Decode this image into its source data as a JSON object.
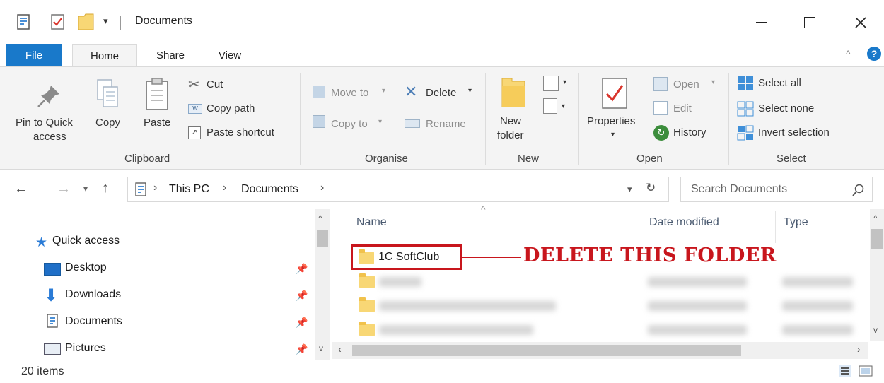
{
  "window": {
    "title": "Documents",
    "controls": {
      "minimize": "—",
      "maximize": "☐",
      "close": "✕"
    }
  },
  "tabs": [
    {
      "label": "File"
    },
    {
      "label": "Home"
    },
    {
      "label": "Share"
    },
    {
      "label": "View"
    }
  ],
  "ribbon": {
    "clipboard": {
      "pin_line1": "Pin to Quick",
      "pin_line2": "access",
      "copy": "Copy",
      "paste": "Paste",
      "cut": "Cut",
      "copy_path": "Copy path",
      "paste_shortcut": "Paste shortcut",
      "group": "Clipboard"
    },
    "organise": {
      "move_to": "Move to",
      "copy_to": "Copy to",
      "delete": "Delete",
      "rename": "Rename",
      "group": "Organise"
    },
    "new": {
      "new_folder_line1": "New",
      "new_folder_line2": "folder",
      "group": "New"
    },
    "open": {
      "properties": "Properties",
      "open": "Open",
      "edit": "Edit",
      "history": "History",
      "group": "Open"
    },
    "select": {
      "select_all": "Select all",
      "select_none": "Select none",
      "invert": "Invert selection",
      "group": "Select"
    }
  },
  "address": {
    "crumb1": "This PC",
    "crumb2": "Documents",
    "sep": "›",
    "search_placeholder": "Search Documents"
  },
  "nav": {
    "items": [
      {
        "label": "Quick access"
      },
      {
        "label": "Desktop"
      },
      {
        "label": "Downloads"
      },
      {
        "label": "Documents"
      },
      {
        "label": "Pictures"
      }
    ]
  },
  "columns": {
    "name": "Name",
    "date": "Date modified",
    "type": "Type"
  },
  "files": [
    {
      "name": "1C SoftClub"
    }
  ],
  "annotation": {
    "text": "DELETE THIS FOLDER"
  },
  "status": {
    "items": "20 items"
  },
  "colors": {
    "accent": "#1979ca",
    "annotation": "#c8161d",
    "folder": "#f8d775"
  }
}
